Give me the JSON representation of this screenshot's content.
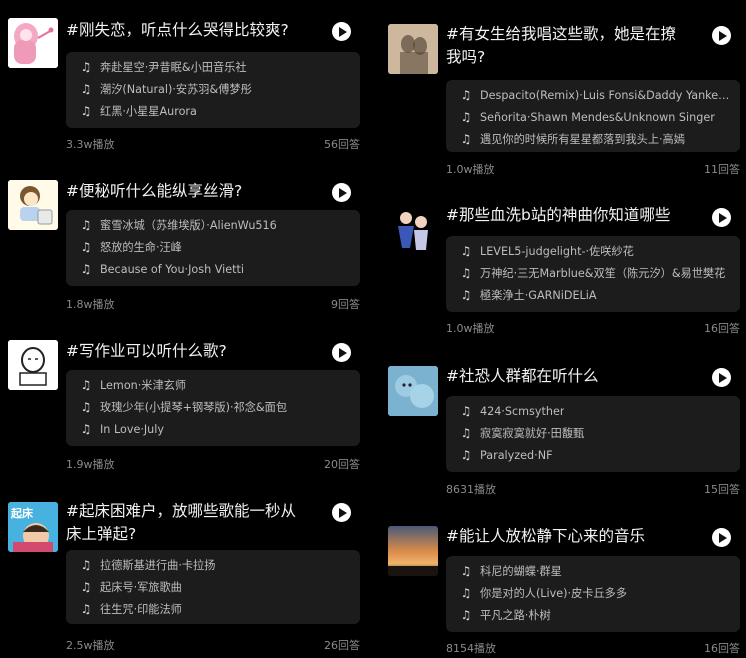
{
  "left": [
    {
      "title": "#刚失恋，听点什么哭得比较爽?",
      "avatar": "pink-character-avatar",
      "songs": [
        "奔赴星空·尹昔眠&小田音乐社",
        "潮汐(Natural)·安苏羽&傅梦彤",
        "红黑·小星星Aurora"
      ],
      "plays": "3.3w播放",
      "answers": "56回答"
    },
    {
      "title": "#便秘听什么能纵享丝滑?",
      "avatar": "cartoon-girl-avatar",
      "songs": [
        "蜜雪冰城（苏维埃版）·AlienWu516",
        "怒放的生命·汪峰",
        "Because of You·Josh Vietti"
      ],
      "plays": "1.8w播放",
      "answers": "9回答"
    },
    {
      "title": "#写作业可以听什么歌?",
      "avatar": "sketch-character-avatar",
      "songs": [
        "Lemon·米津玄师",
        "玫瑰少年(小提琴+钢琴版)·祁念&面包",
        "In Love·July"
      ],
      "plays": "1.9w播放",
      "answers": "20回答"
    },
    {
      "title": "#起床困难户，放哪些歌能一秒从床上弹起?",
      "avatar": "wakeup-cartoon-avatar",
      "avatar_text": "起床",
      "songs": [
        "拉德斯基进行曲·卡拉扬",
        "起床号·军旅歌曲",
        "往生咒·印能法师"
      ],
      "plays": "2.5w播放",
      "answers": "26回答"
    }
  ],
  "right": [
    {
      "title": "#有女生给我唱这些歌，她是在撩我吗?",
      "avatar": "shadow-photo-avatar",
      "songs": [
        "Despacito(Remix)·Luis Fonsi&Daddy Yankee…",
        "Señorita·Shawn Mendes&Unknown Singer",
        "遇见你的时候所有星星都落到我头上·高嫣"
      ],
      "plays": "1.0w播放",
      "answers": "11回答"
    },
    {
      "title": "#那些血洗b站的神曲你知道哪些",
      "avatar": "anime-dancers-avatar",
      "songs": [
        "LEVEL5-judgelight-·佐咲紗花",
        "万神纪·三无Marblue&双笙（陈元汐）&易世樊花",
        "極楽浄土·GARNiDELiA"
      ],
      "plays": "1.0w播放",
      "answers": "16回答"
    },
    {
      "title": "#社恐人群都在听什么",
      "avatar": "blue-creature-avatar",
      "songs": [
        "424·Scmsyther",
        "寂寞寂寞就好·田馥甄",
        "Paralyzed·NF"
      ],
      "plays": "8631播放",
      "answers": "15回答"
    },
    {
      "title": "#能让人放松静下心来的音乐",
      "avatar": "sunset-photo-avatar",
      "songs": [
        "科尼的蝴蝶·群星",
        "你是对的人(Live)·皮卡丘多多",
        "平凡之路·朴树"
      ],
      "plays": "8154播放",
      "answers": "16回答"
    }
  ],
  "icons": {
    "music_note": "♫"
  }
}
